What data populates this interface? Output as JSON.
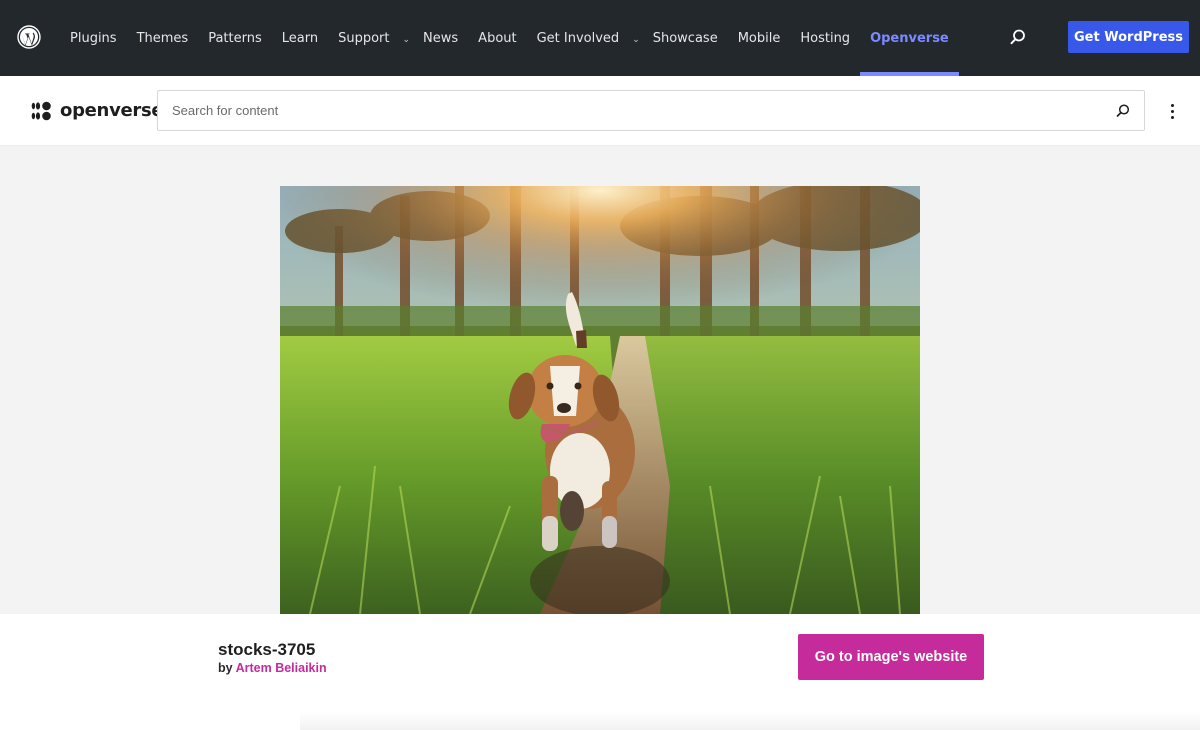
{
  "wp_bar": {
    "logo_icon": "wordpress-logo-icon",
    "nav": [
      {
        "label": "Plugins",
        "has_dropdown": false
      },
      {
        "label": "Themes",
        "has_dropdown": false
      },
      {
        "label": "Patterns",
        "has_dropdown": false
      },
      {
        "label": "Learn",
        "has_dropdown": false
      },
      {
        "label": "Support",
        "has_dropdown": true
      },
      {
        "label": "News",
        "has_dropdown": false
      },
      {
        "label": "About",
        "has_dropdown": false
      },
      {
        "label": "Get Involved",
        "has_dropdown": true
      },
      {
        "label": "Showcase",
        "has_dropdown": false
      },
      {
        "label": "Mobile",
        "has_dropdown": false
      },
      {
        "label": "Hosting",
        "has_dropdown": false
      },
      {
        "label": "Openverse",
        "has_dropdown": false,
        "active": true
      }
    ],
    "search_icon": "search-icon",
    "cta_label": "Get WordPress",
    "accent_color": "#3858e9",
    "active_color": "#7b8bff"
  },
  "openverse_header": {
    "logo_text": "openverse",
    "search": {
      "placeholder": "Search for content",
      "value": ""
    },
    "search_icon": "search-icon",
    "menu_icon": "more-vertical-icon"
  },
  "image": {
    "alt": "Beagle dog running along a sunlit grassy path between palm trees",
    "title": "stocks-3705",
    "by_label": "by",
    "creator": "Artem Beliaikin",
    "cta_label": "Go to image's website",
    "brand_color": "#c52b9b"
  }
}
